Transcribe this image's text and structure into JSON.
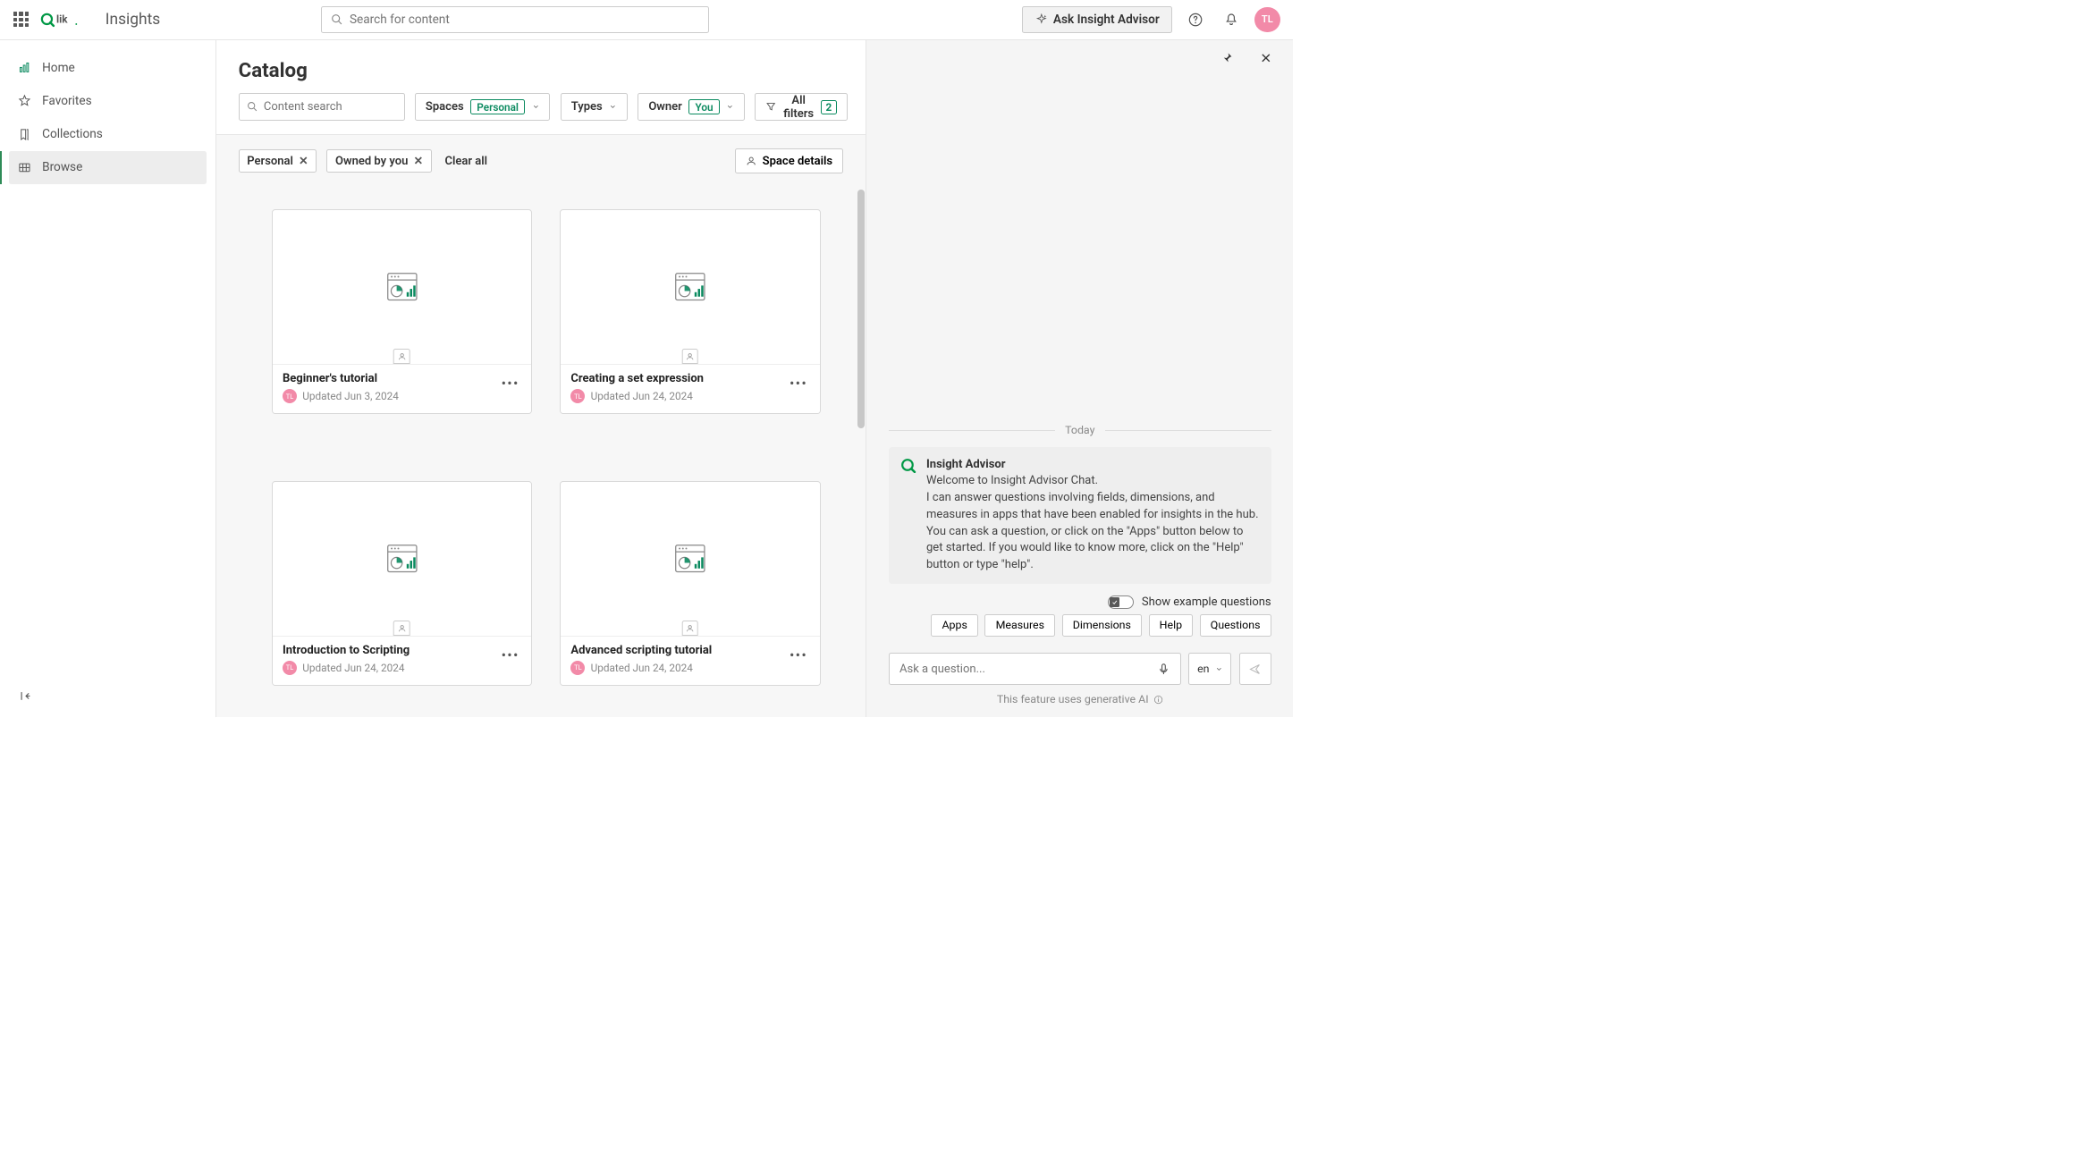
{
  "header": {
    "breadcrumb": "Insights",
    "search_placeholder": "Search for content",
    "ask_button": "Ask Insight Advisor",
    "avatar_initials": "TL"
  },
  "sidebar": {
    "items": [
      {
        "label": "Home",
        "icon": "home"
      },
      {
        "label": "Favorites",
        "icon": "star"
      },
      {
        "label": "Collections",
        "icon": "bookmark"
      },
      {
        "label": "Browse",
        "icon": "grid",
        "active": true
      }
    ]
  },
  "catalog": {
    "title": "Catalog",
    "content_search_placeholder": "Content search",
    "filters": {
      "spaces": {
        "label": "Spaces",
        "badge": "Personal"
      },
      "types": {
        "label": "Types"
      },
      "owner": {
        "label": "Owner",
        "badge": "You"
      },
      "all_filters": {
        "label": "All filters",
        "count": "2"
      }
    },
    "chips": [
      {
        "label": "Personal"
      },
      {
        "label": "Owned by you"
      }
    ],
    "clear_all": "Clear all",
    "space_details": "Space details",
    "cards": [
      {
        "title": "Beginner's tutorial",
        "updated": "Updated Jun 3, 2024",
        "avatar": "TL"
      },
      {
        "title": "Creating a set expression",
        "updated": "Updated Jun 24, 2024",
        "avatar": "TL"
      },
      {
        "title": "Introduction to Scripting",
        "updated": "Updated Jun 24, 2024",
        "avatar": "TL"
      },
      {
        "title": "Advanced scripting tutorial",
        "updated": "Updated Jun 24, 2024",
        "avatar": "TL"
      }
    ]
  },
  "chat": {
    "date": "Today",
    "advisor_name": "Insight Advisor",
    "welcome_1": "Welcome to Insight Advisor Chat.",
    "welcome_2": "I can answer questions involving fields, dimensions, and measures in apps that have been enabled for insights in the hub.",
    "welcome_3": "You can ask a question, or click on the \"Apps\" button below to get started. If you would like to know more, click on the \"Help\" button or type \"help\".",
    "show_examples": "Show example questions",
    "quick": [
      "Apps",
      "Measures",
      "Dimensions",
      "Help",
      "Questions"
    ],
    "input_placeholder": "Ask a question...",
    "lang": "en",
    "ai_note": "This feature uses generative AI"
  }
}
